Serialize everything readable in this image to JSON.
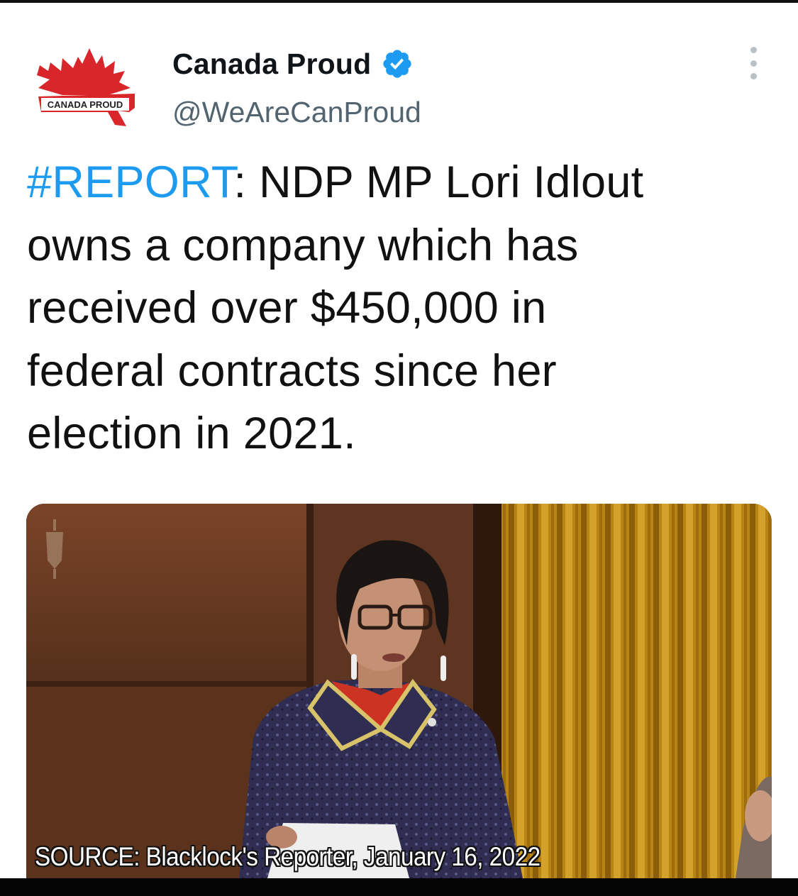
{
  "tweet": {
    "author": {
      "display_name": "Canada Proud",
      "handle": "@WeAreCanProud",
      "verified": true,
      "avatar_text": "CANADA PROUD",
      "avatar_icon": "maple-leaf-icon"
    },
    "more_icon": "more-options-icon",
    "text": {
      "hashtag": "#REPORT",
      "body": ": NDP MP Lori Idlout\nowns a company which has\nreceived over $450,000 in\nfederal contracts since her\nelection in 2021."
    },
    "media": {
      "caption": "SOURCE: Blacklock's Reporter, January 16, 2022"
    }
  },
  "colors": {
    "hashtag": "#1d9bf0",
    "verified": "#1d9bf0",
    "brand_red": "#d9262b"
  }
}
